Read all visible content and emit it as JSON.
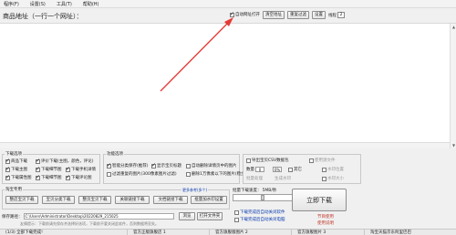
{
  "menu": [
    "程序(F)",
    "设置(S)",
    "工具(T)",
    "帮助(H)"
  ],
  "toolbar": {
    "url_label": "商品地址（一行一个网址）：",
    "auto_open_label": "自动网址打开",
    "clear_addr_label": "清空地址",
    "remove_dup_label": "重复过滤",
    "settings_label": "设置",
    "threads_label": "线程",
    "threads_value": "2"
  },
  "annotation": {
    "color": "#e53935"
  },
  "options": {
    "title": "下载选项",
    "items": [
      {
        "label": "商品下载",
        "checked": true
      },
      {
        "label": "评价下载(主图，颜色，评论)",
        "checked": true
      },
      {
        "label": "下载主图",
        "checked": true
      },
      {
        "label": "下载细节图",
        "checked": true
      },
      {
        "label": "下载手机详情",
        "checked": true
      },
      {
        "label": "下载属性图",
        "checked": true
      },
      {
        "label": "下载细节图",
        "checked": true
      },
      {
        "label": "下载评论图",
        "checked": true
      }
    ]
  },
  "func": {
    "title": "功能选项",
    "items": [
      {
        "label": "智能分类保存(推荐)",
        "checked": true
      },
      {
        "label": "显示宝贝标题",
        "checked": true
      },
      {
        "label": "自动删除详情页中的图片",
        "checked": false
      },
      {
        "label": "过滤重复的图片(300像素图片过滤)",
        "checked": false
      },
      {
        "label": "删除1万像素以下的图片(稳步完成)",
        "checked": false
      }
    ]
  },
  "right_opts": {
    "items": [
      {
        "label": "导出宝贝CSV数据包",
        "checked": false
      },
      {
        "label": "使用源文件",
        "checked": false
      }
    ],
    "row2": [
      "数量",
      "0",
      "0%",
      "其它"
    ],
    "sub": [
      "批量处理",
      "生成水印"
    ],
    "check_more": [
      {
        "label": "水印位置",
        "checked": false
      },
      {
        "label": "水印大小",
        "checked": false
      }
    ]
  },
  "tools": {
    "title": "淘宝专用",
    "buttons": [
      "整店宝贝下载",
      "宝贝分类下载",
      "整页宝贝下载",
      "关联链接下载",
      "文档链接下载",
      "批量加水印设置"
    ],
    "extra_label": "更多参考(多个)"
  },
  "batch": {
    "label": "批量下载速度：",
    "value": "5MB/秒",
    "checks": [
      {
        "label": "下载完成后自动关闭软件",
        "checked": false
      },
      {
        "label": "下载完成后自动关闭电脑",
        "checked": false
      }
    ]
  },
  "save": {
    "label": "保存路径：",
    "path": "C:\\Users\\Administrator\\Desktop\\20220829_215025",
    "browse_label": "浏览",
    "open_label": "打开文件夹",
    "tip": "友情提示：下载前请先保存并选择好选项，下载前不要关闭此软件，否则数据将丢失。"
  },
  "start": {
    "label": "立即下载",
    "sub": [
      "节目使用",
      "使用说明"
    ]
  },
  "status": [
    "(1/3) 全部下载完成!",
    "官方正版旗舰店 1",
    "官方旗舰版图片 2",
    "官方旗舰图片 3",
    "淘宝天猫京东阿里巴巴"
  ]
}
